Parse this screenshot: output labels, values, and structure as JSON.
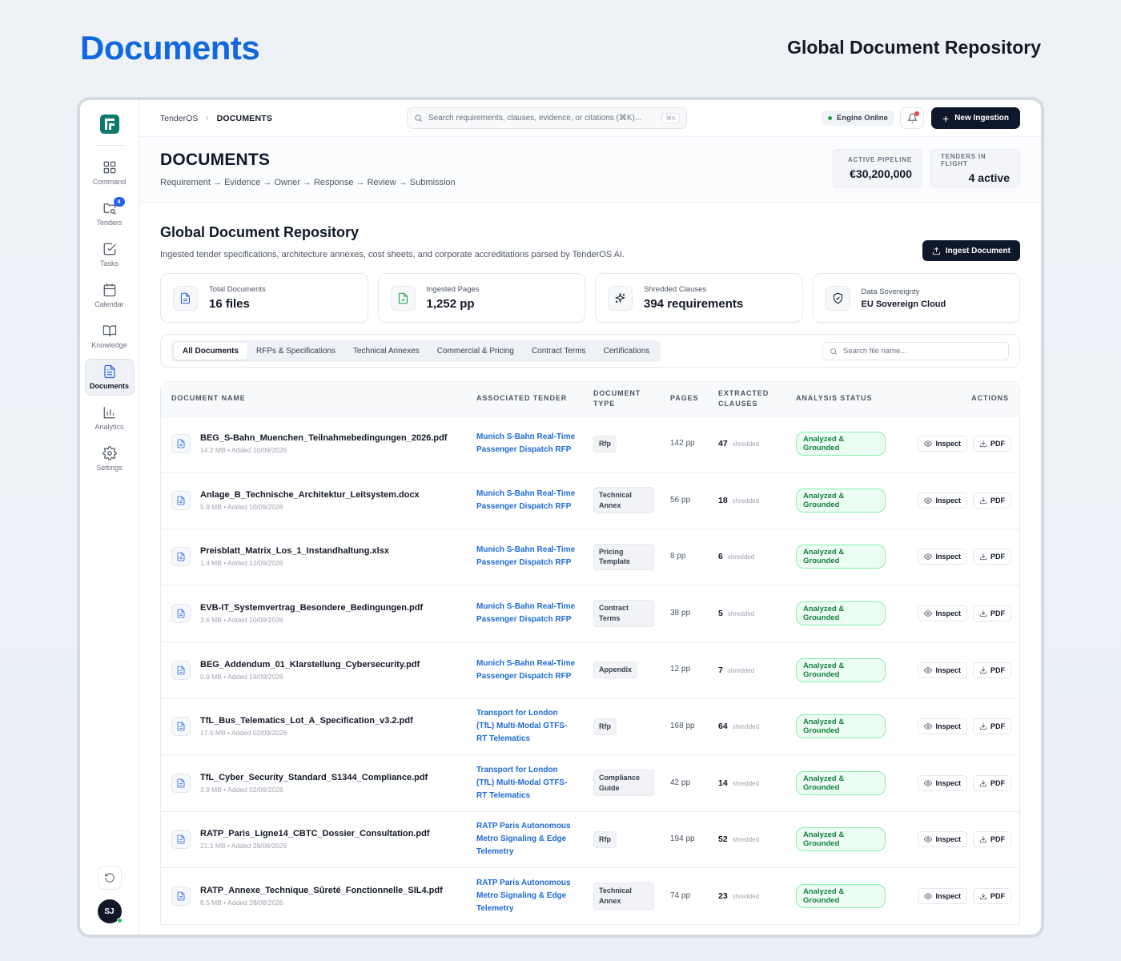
{
  "page": {
    "title": "Documents",
    "subtitle": "Global Document Repository"
  },
  "sidebar": {
    "items": [
      {
        "label": "Command",
        "icon": "grid-icon"
      },
      {
        "label": "Tenders",
        "icon": "folder-search-icon",
        "badge": "4"
      },
      {
        "label": "Tasks",
        "icon": "checkbox-icon"
      },
      {
        "label": "Calendar",
        "icon": "calendar-icon"
      },
      {
        "label": "Knowledge",
        "icon": "book-icon"
      },
      {
        "label": "Documents",
        "icon": "document-icon",
        "active": true
      },
      {
        "label": "Analytics",
        "icon": "bar-chart-icon"
      },
      {
        "label": "Settings",
        "icon": "gear-icon"
      }
    ],
    "avatar_initials": "SJ"
  },
  "topbar": {
    "breadcrumb_root": "TenderOS",
    "breadcrumb_current": "DOCUMENTS",
    "search_placeholder": "Search requirements, clauses, evidence, or citations (⌘K)...",
    "search_shortcut": "⌘K",
    "engine_status": "Engine Online",
    "new_button": "New Ingestion"
  },
  "header": {
    "title": "DOCUMENTS",
    "flow": "Requirement → Evidence → Owner → Response → Review → Submission",
    "metrics": [
      {
        "label": "ACTIVE PIPELINE",
        "value": "€30,200,000"
      },
      {
        "label": "TENDERS IN FLIGHT",
        "value": "4 active"
      }
    ]
  },
  "section": {
    "title": "Global Document Repository",
    "description": "Ingested tender specifications, architecture annexes, cost sheets, and corporate accreditations parsed by TenderOS AI.",
    "ingest_button": "Ingest Document"
  },
  "stats": [
    {
      "label": "Total Documents",
      "value": "16 files",
      "icon": "document-icon"
    },
    {
      "label": "Ingested Pages",
      "value": "1,252 pp",
      "icon": "file-check-icon"
    },
    {
      "label": "Shredded Clauses",
      "value": "394 requirements",
      "icon": "sparkle-icon"
    },
    {
      "label": "Data Sovereignty",
      "value": "EU Sovereign Cloud",
      "icon": "shield-check-icon"
    }
  ],
  "filters": {
    "tabs": [
      "All Documents",
      "RFPs & Specifications",
      "Technical Annexes",
      "Commercial & Pricing",
      "Contract Terms",
      "Certifications"
    ],
    "active_tab": "All Documents",
    "search_placeholder": "Search file name..."
  },
  "table": {
    "headers": {
      "name": "DOCUMENT NAME",
      "tender": "ASSOCIATED TENDER",
      "type": "DOCUMENT TYPE",
      "pages": "PAGES",
      "clauses": "EXTRACTED CLAUSES",
      "status": "ANALYSIS STATUS",
      "actions": "ACTIONS"
    },
    "inspect_label": "Inspect",
    "pdf_label": "PDF",
    "shredded_label": "shredded",
    "rows": [
      {
        "name": "BEG_S-Bahn_Muenchen_Teilnahmebedingungen_2026.pdf",
        "meta": "14.2 MB • Added 10/09/2026",
        "tender": "Munich S-Bahn Real-Time Passenger Dispatch RFP",
        "type": "Rfp",
        "pages": "142 pp",
        "clauses": "47",
        "status": "Analyzed & Grounded"
      },
      {
        "name": "Anlage_B_Technische_Architektur_Leitsystem.docx",
        "meta": "5.9 MB • Added 10/09/2026",
        "tender": "Munich S-Bahn Real-Time Passenger Dispatch RFP",
        "type": "Technical Annex",
        "pages": "56 pp",
        "clauses": "18",
        "status": "Analyzed & Grounded"
      },
      {
        "name": "Preisblatt_Matrix_Los_1_Instandhaltung.xlsx",
        "meta": "1.4 MB • Added 12/09/2026",
        "tender": "Munich S-Bahn Real-Time Passenger Dispatch RFP",
        "type": "Pricing Template",
        "pages": "8 pp",
        "clauses": "6",
        "status": "Analyzed & Grounded"
      },
      {
        "name": "EVB-IT_Systemvertrag_Besondere_Bedingungen.pdf",
        "meta": "3.6 MB • Added 10/09/2026",
        "tender": "Munich S-Bahn Real-Time Passenger Dispatch RFP",
        "type": "Contract Terms",
        "pages": "38 pp",
        "clauses": "5",
        "status": "Analyzed & Grounded"
      },
      {
        "name": "BEG_Addendum_01_Klarstellung_Cybersecurity.pdf",
        "meta": "0.9 MB • Added 19/09/2026",
        "tender": "Munich S-Bahn Real-Time Passenger Dispatch RFP",
        "type": "Appendix",
        "pages": "12 pp",
        "clauses": "7",
        "status": "Analyzed & Grounded"
      },
      {
        "name": "TfL_Bus_Telematics_Lot_A_Specification_v3.2.pdf",
        "meta": "17.5 MB • Added 02/09/2026",
        "tender": "Transport for London (TfL) Multi-Modal GTFS-RT Telematics",
        "type": "Rfp",
        "pages": "168 pp",
        "clauses": "64",
        "status": "Analyzed & Grounded"
      },
      {
        "name": "TfL_Cyber_Security_Standard_S1344_Compliance.pdf",
        "meta": "3.9 MB • Added 02/09/2026",
        "tender": "Transport for London (TfL) Multi-Modal GTFS-RT Telematics",
        "type": "Compliance Guide",
        "pages": "42 pp",
        "clauses": "14",
        "status": "Analyzed & Grounded"
      },
      {
        "name": "RATP_Paris_Ligne14_CBTC_Dossier_Consultation.pdf",
        "meta": "21.1 MB • Added 28/08/2026",
        "tender": "RATP Paris Autonomous Metro Signaling & Edge Telemetry",
        "type": "Rfp",
        "pages": "194 pp",
        "clauses": "52",
        "status": "Analyzed & Grounded"
      },
      {
        "name": "RATP_Annexe_Technique_Sûreté_Fonctionnelle_SIL4.pdf",
        "meta": "8.5 MB • Added 28/08/2026",
        "tender": "RATP Paris Autonomous Metro Signaling & Edge Telemetry",
        "type": "Technical Annex",
        "pages": "74 pp",
        "clauses": "23",
        "status": "Analyzed & Grounded"
      }
    ]
  }
}
